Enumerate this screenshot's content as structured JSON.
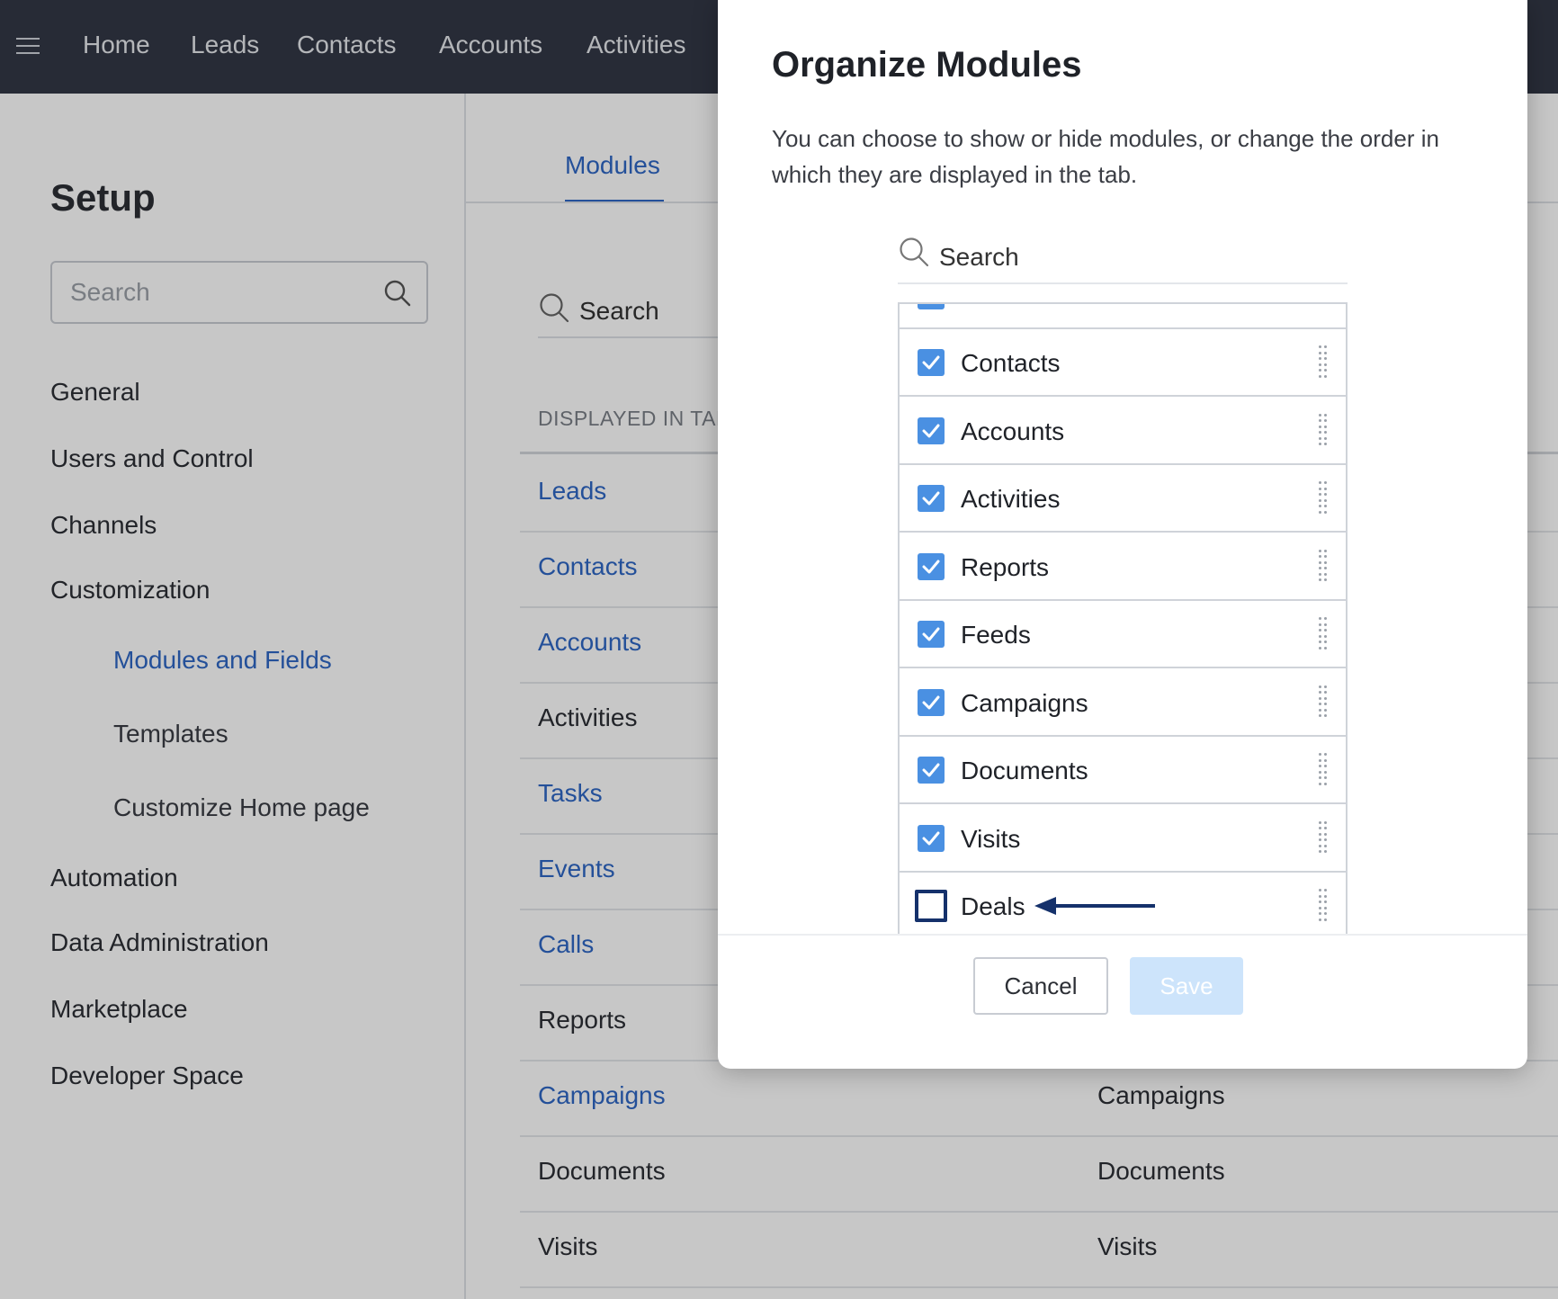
{
  "topbar": {
    "nav": [
      "Home",
      "Leads",
      "Contacts",
      "Accounts",
      "Activities"
    ]
  },
  "sidebar": {
    "title": "Setup",
    "search_placeholder": "Search",
    "items": [
      "General",
      "Users and Control",
      "Channels",
      "Customization"
    ],
    "sub_items": [
      "Modules and Fields",
      "Templates",
      "Customize Home page"
    ],
    "items_after": [
      "Automation",
      "Data Administration",
      "Marketplace",
      "Developer Space"
    ]
  },
  "main": {
    "tab": "Modules",
    "search_placeholder": "Search",
    "displayed_header": "DISPLAYED IN TAB",
    "rows": [
      {
        "name": "Leads",
        "alias": ""
      },
      {
        "name": "Contacts",
        "alias": ""
      },
      {
        "name": "Accounts",
        "alias": ""
      },
      {
        "name": "Activities",
        "alias": ""
      },
      {
        "name": "Tasks",
        "alias": ""
      },
      {
        "name": "Events",
        "alias": ""
      },
      {
        "name": "Calls",
        "alias": ""
      },
      {
        "name": "Reports",
        "alias": ""
      },
      {
        "name": "Campaigns",
        "alias": "Campaigns"
      },
      {
        "name": "Documents",
        "alias": "Documents"
      },
      {
        "name": "Visits",
        "alias": "Visits"
      }
    ]
  },
  "modal": {
    "title": "Organize Modules",
    "description": "You can choose to show or hide modules, or change the order in which they are displayed in the tab.",
    "search_placeholder": "Search",
    "modules": [
      {
        "label": "Contacts",
        "checked": true
      },
      {
        "label": "Accounts",
        "checked": true
      },
      {
        "label": "Activities",
        "checked": true
      },
      {
        "label": "Reports",
        "checked": true
      },
      {
        "label": "Feeds",
        "checked": true
      },
      {
        "label": "Campaigns",
        "checked": true
      },
      {
        "label": "Documents",
        "checked": true
      },
      {
        "label": "Visits",
        "checked": true
      },
      {
        "label": "Deals",
        "checked": false
      }
    ],
    "cancel_label": "Cancel",
    "save_label": "Save"
  },
  "colors": {
    "topbar": "#323846",
    "link": "#2f67c5",
    "checkbox": "#4a90e2",
    "arrow": "#15316b",
    "save_disabled": "#cde4fb"
  },
  "icons": [
    "hamburger-icon",
    "search-icon",
    "checkmark-icon",
    "drag-handle-icon",
    "arrow-left-icon"
  ]
}
